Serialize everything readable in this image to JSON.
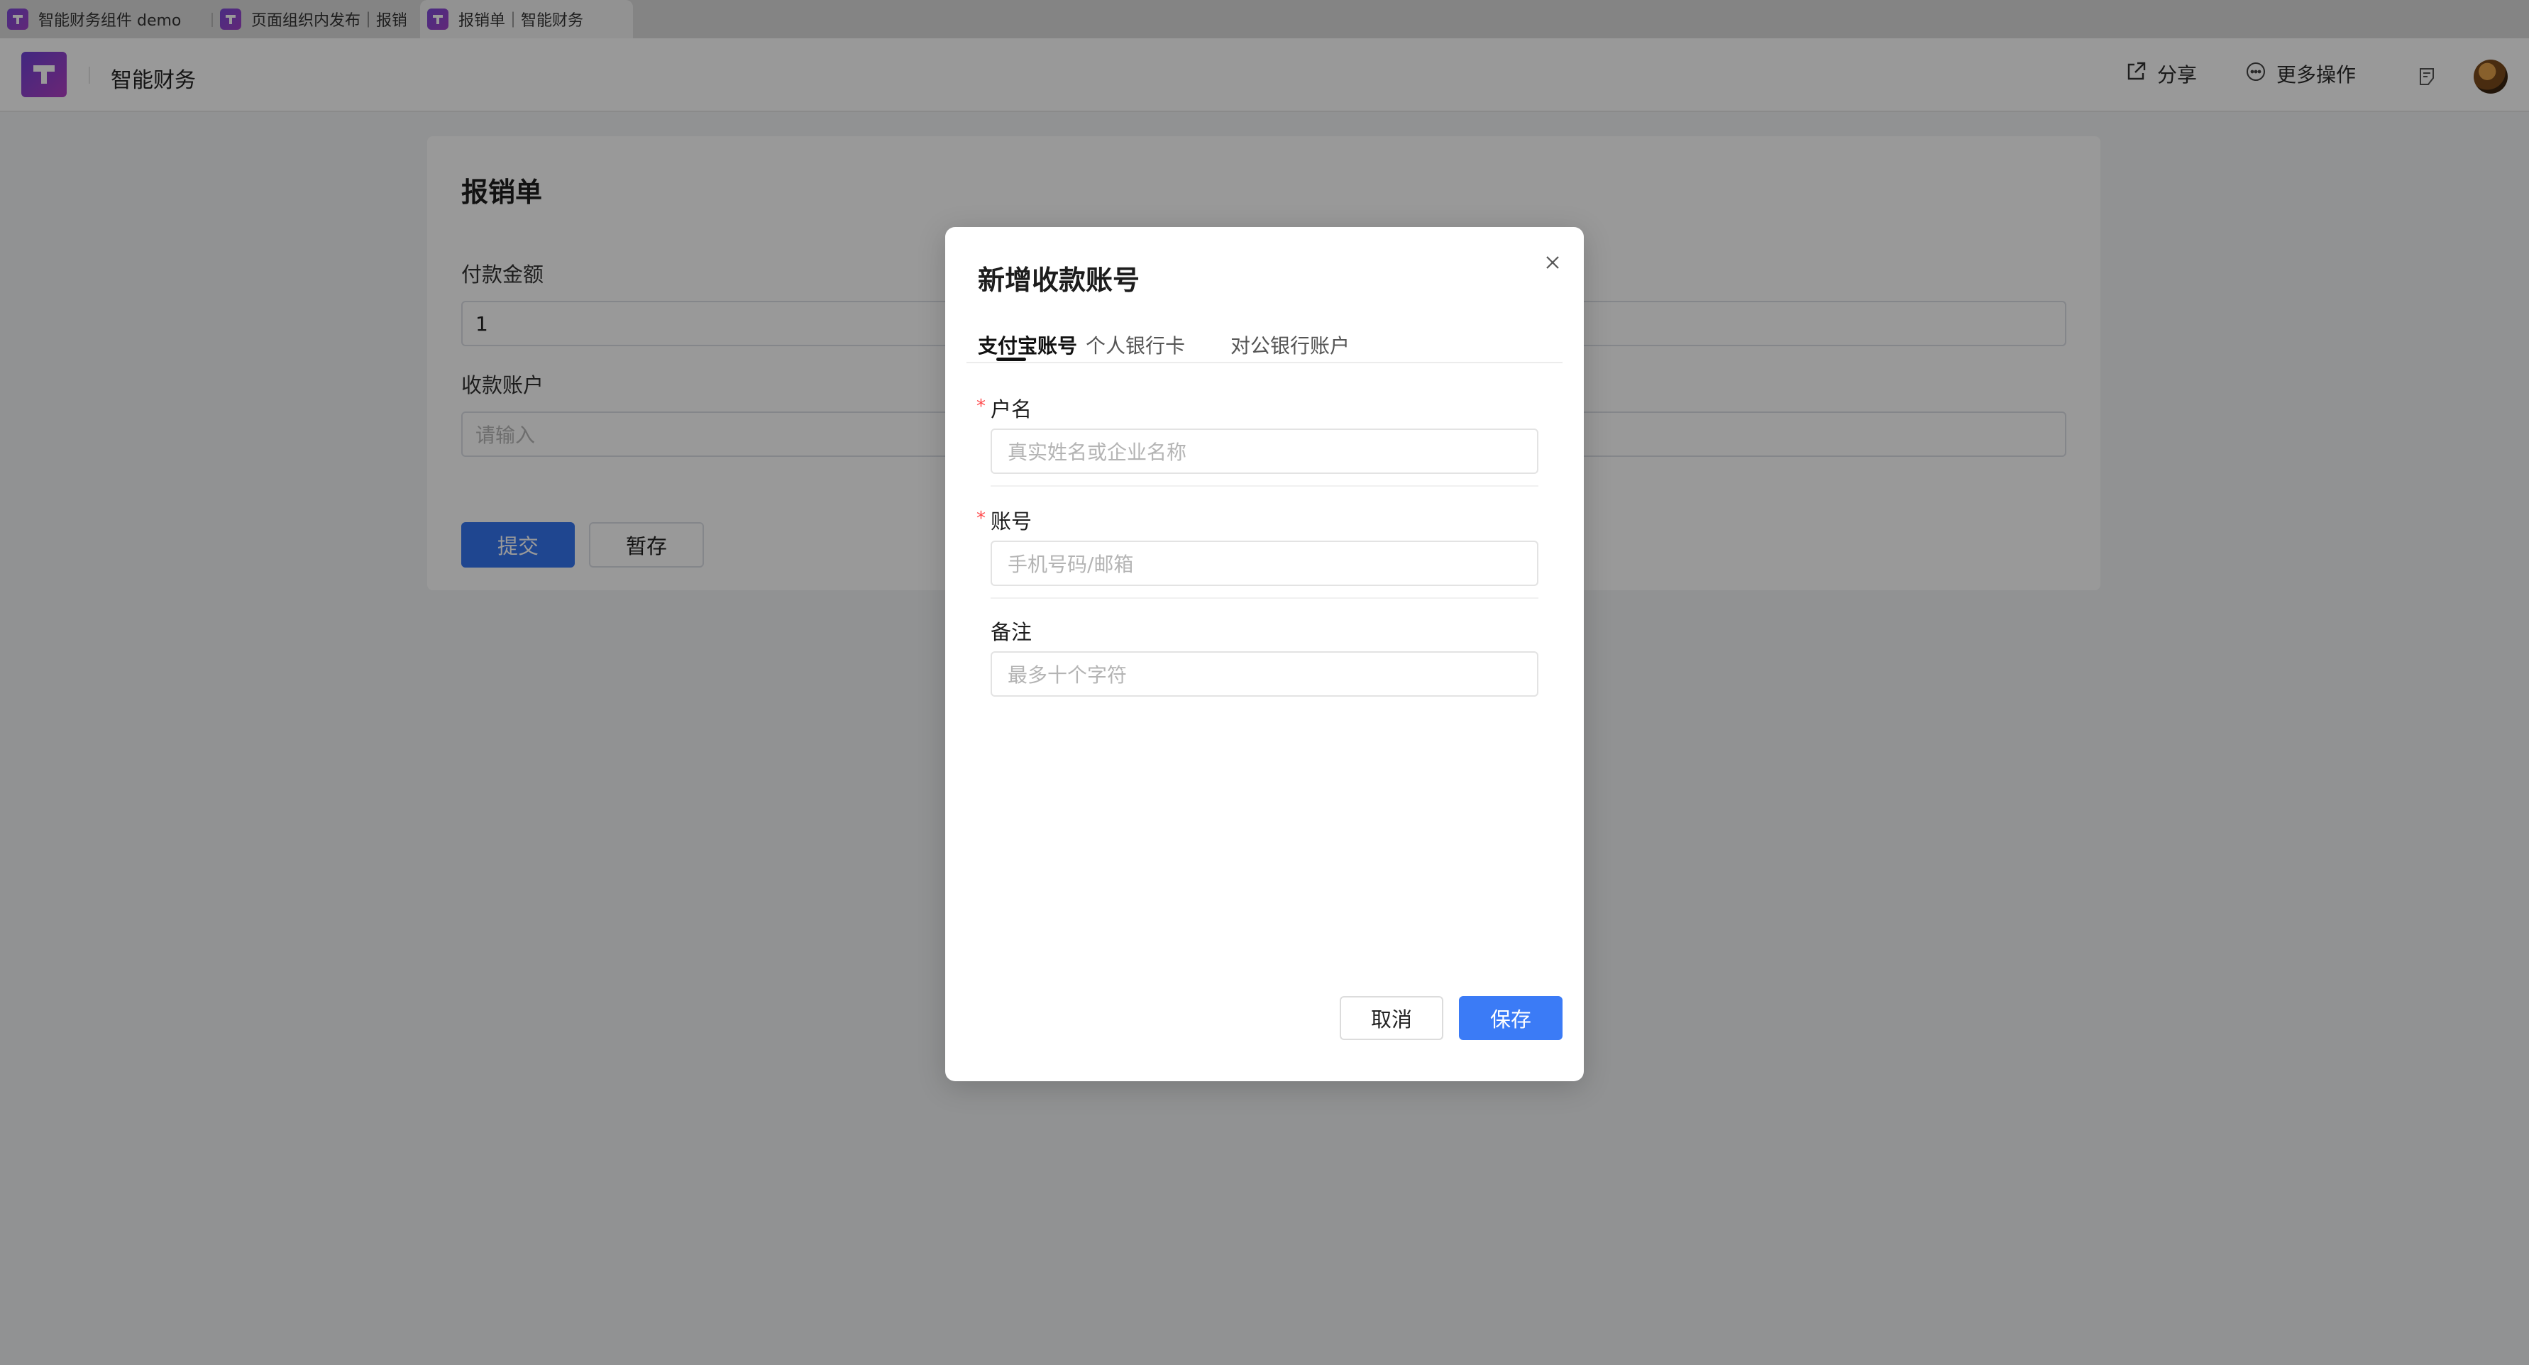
{
  "browser_tabs": [
    {
      "label": "智能财务组件 demo",
      "icon": "app-logo-icon"
    },
    {
      "label": "页面组织内发布｜报销",
      "icon": "app-logo-icon"
    },
    {
      "label": "报销单｜智能财务",
      "icon": "app-logo-icon",
      "active": true
    }
  ],
  "header": {
    "app_title": "智能财务",
    "share_label": "分享",
    "more_label": "更多操作"
  },
  "form": {
    "title": "报销单",
    "amount_label": "付款金额",
    "amount_value": "1",
    "account_label": "收款账户",
    "account_placeholder": "请输入",
    "submit_label": "提交",
    "draft_label": "暂存"
  },
  "modal": {
    "title": "新增收款账号",
    "tabs": [
      {
        "label": "支付宝账号",
        "active": true
      },
      {
        "label": "个人银行卡",
        "active": false
      },
      {
        "label": "对公银行账户",
        "active": false
      }
    ],
    "required_mark": "*",
    "fields": {
      "name": {
        "label": "户名",
        "placeholder": "真实姓名或企业名称",
        "required": true
      },
      "account": {
        "label": "账号",
        "placeholder": "手机号码/邮箱",
        "required": true
      },
      "remark": {
        "label": "备注",
        "placeholder": "最多十个字符",
        "required": false
      }
    },
    "cancel_label": "取消",
    "save_label": "保存"
  },
  "colors": {
    "primary": "#3b7bf6",
    "brand": "#7b4bd8",
    "required": "#ff4d4f"
  }
}
